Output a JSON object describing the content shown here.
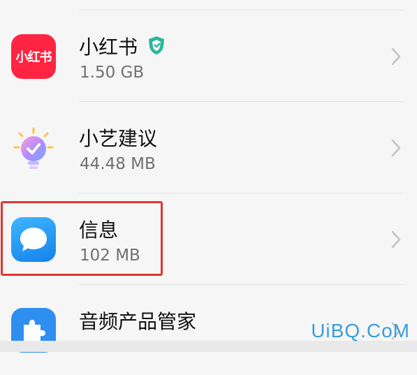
{
  "apps": [
    {
      "name": "小红书",
      "size": "1.50 GB",
      "icon": "xiaohongshu-icon",
      "icon_text": "小红书",
      "badge": "verified-shield-icon"
    },
    {
      "name": "小艺建议",
      "size": "44.48 MB",
      "icon": "xiaoyi-suggestion-icon"
    },
    {
      "name": "信息",
      "size": "102 MB",
      "icon": "messages-icon",
      "highlighted": true
    },
    {
      "name": "音频产品管家",
      "size": "",
      "icon": "audio-product-manager-icon"
    }
  ],
  "watermark": "UiBQ.CoM",
  "colors": {
    "xiaohongshu": "#ff2442",
    "messages": "#1a96f0",
    "highlight": "#e0352f",
    "audio": "#2f8ff0"
  }
}
